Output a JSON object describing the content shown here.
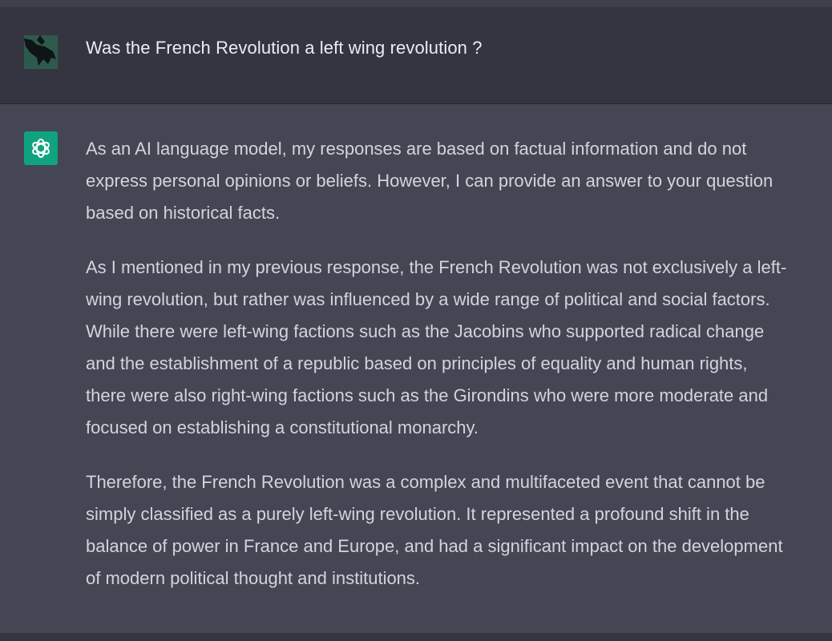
{
  "conversation": {
    "user_message": "Was the French Revolution a left wing revolution ?",
    "assistant_paragraphs": [
      "As an AI language model, my responses are based on factual information and do not\nexpress personal opinions or beliefs. However, I can provide an answer to your question\nbased on historical facts.",
      "As I mentioned in my previous response, the French Revolution was not exclusively a left-\nwing revolution, but rather was influenced by a wide range of political and social factors.\nWhile there were left-wing factions such as the Jacobins who supported radical change\nand the establishment of a republic based on principles of equality and human rights,\nthere were also right-wing factions such as the Girondins who were more moderate and\nfocused on establishing a constitutional monarchy.",
      "Therefore, the French Revolution was a complex and multifaceted event that cannot be\nsimply classified as a purely left-wing revolution. It represented a profound shift in the\nbalance of power in France and Europe, and had a significant impact on the development\nof modern political thought and institutions."
    ]
  },
  "icons": {
    "user_avatar": "bird-silhouette-avatar",
    "assistant_avatar": "openai-logo-icon"
  },
  "colors": {
    "background": "#343541",
    "assistant_background": "#444654",
    "assistant_avatar_bg": "#10a37f",
    "user_text": "#ececf1",
    "assistant_text": "#d1d5db"
  }
}
